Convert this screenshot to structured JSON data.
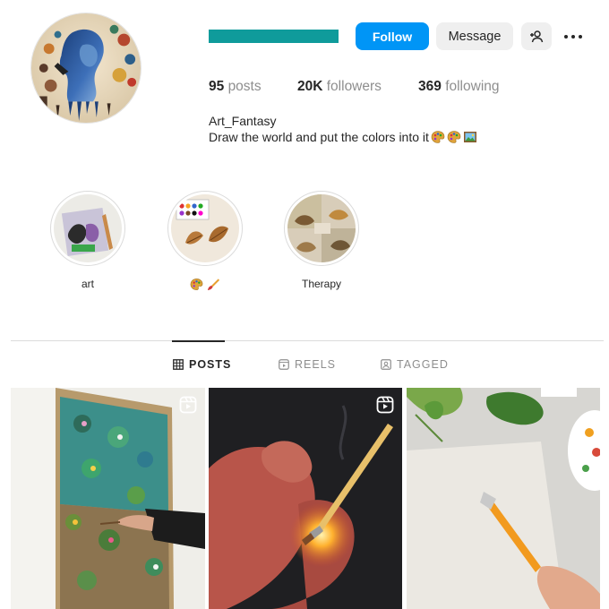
{
  "profile": {
    "name": "Art_Fantasy",
    "bio": "Draw the world and put the colors into it",
    "bio_emojis": [
      "palette-emoji",
      "palette-emoji",
      "framed-picture-emoji"
    ],
    "username_bar_color": "#0f9b9b"
  },
  "actions": {
    "follow_label": "Follow",
    "message_label": "Message",
    "add_user_icon": "person-add-icon",
    "more_icon": "more-horizontal-icon"
  },
  "stats": {
    "posts_count": "95",
    "posts_label": "posts",
    "followers_count": "20K",
    "followers_label": "followers",
    "following_count": "369",
    "following_label": "following"
  },
  "highlights": [
    {
      "label": "art"
    },
    {
      "label": "",
      "icons": [
        "palette-emoji",
        "paintbrush-emoji"
      ]
    },
    {
      "label": "Therapy"
    }
  ],
  "tabs": [
    {
      "label": "POSTS",
      "icon": "grid-icon",
      "active": true
    },
    {
      "label": "REELS",
      "icon": "reels-icon",
      "active": false
    },
    {
      "label": "TAGGED",
      "icon": "tagged-icon",
      "active": false
    }
  ],
  "posts": [
    {
      "type": "reel",
      "icon": "reel-icon"
    },
    {
      "type": "reel",
      "icon": "reel-icon"
    },
    {
      "type": "image"
    }
  ],
  "colors": {
    "follow_button": "#0095f6",
    "secondary_button": "#efefef",
    "muted_text": "#8e8e8e",
    "primary_text": "#262626"
  }
}
